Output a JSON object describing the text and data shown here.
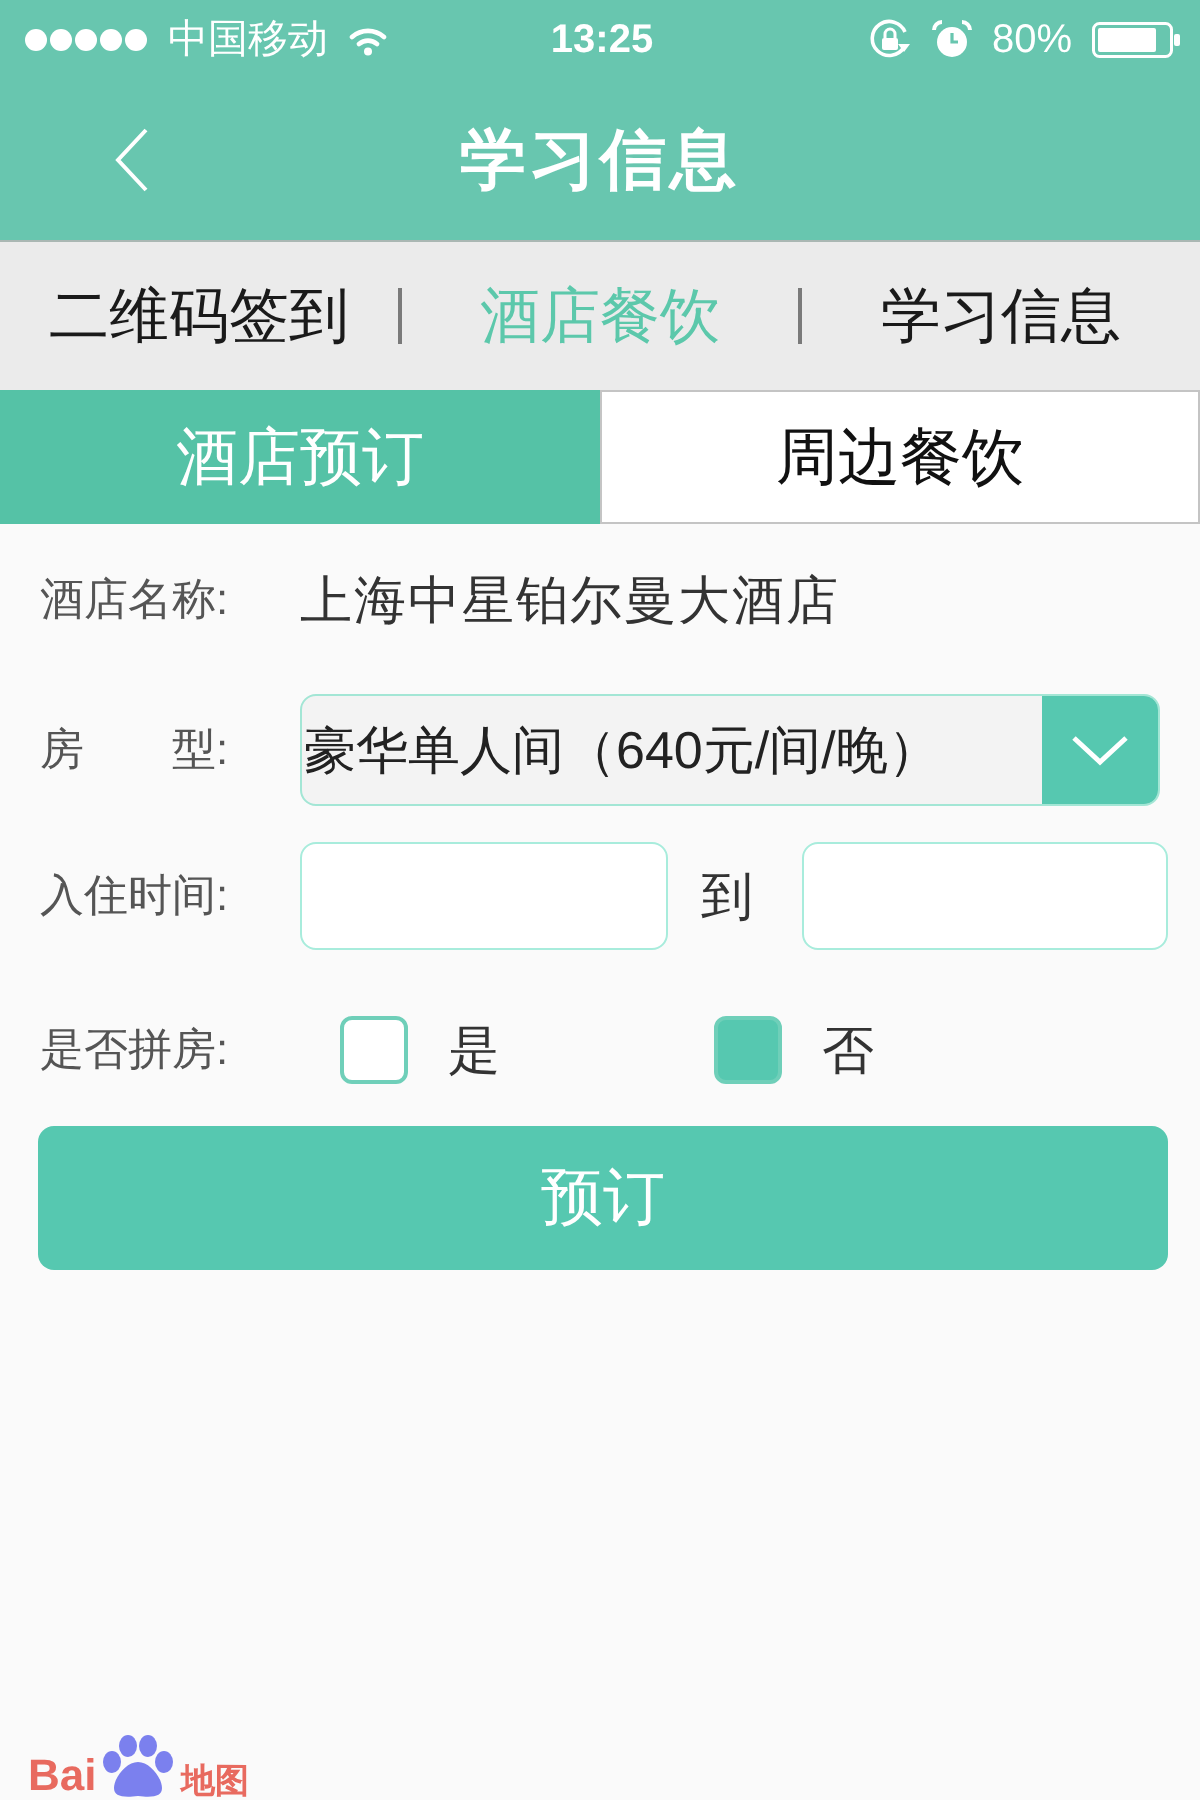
{
  "status_bar": {
    "carrier": "中国移动",
    "time": "13:25",
    "battery": "80%"
  },
  "nav_bar": {
    "title": "学习信息"
  },
  "segments": [
    {
      "label": "二维码签到",
      "selected": false
    },
    {
      "label": "酒店餐饮",
      "selected": true
    },
    {
      "label": "学习信息",
      "selected": false
    }
  ],
  "tabs": [
    {
      "label": "酒店预订",
      "selected": true
    },
    {
      "label": "周边餐饮",
      "selected": false
    }
  ],
  "form": {
    "hotel": {
      "label": "酒店名称:",
      "value": "上海中星铂尔曼大酒店"
    },
    "room_type": {
      "label": "房　　型:",
      "value": "豪华单人间（640元/间/晚）"
    },
    "stay": {
      "label": "入住时间:",
      "separator": "到"
    },
    "share_room": {
      "label": "是否拼房:",
      "options": [
        {
          "label": "是",
          "selected": false
        },
        {
          "label": "否",
          "selected": true
        }
      ]
    }
  },
  "submit_button": "预订",
  "map_logo": {
    "text": "Bai",
    "suffix": "地图"
  }
}
